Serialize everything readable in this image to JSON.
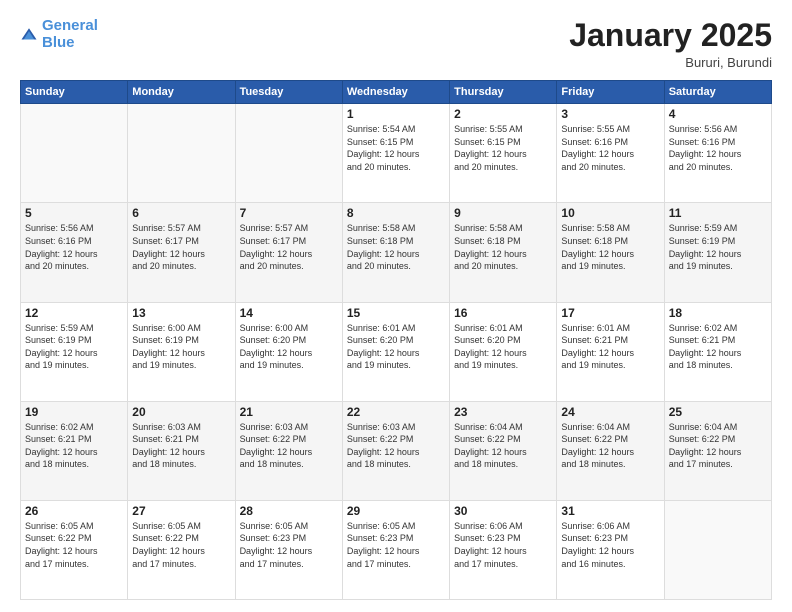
{
  "header": {
    "logo_line1": "General",
    "logo_line2": "Blue",
    "month": "January 2025",
    "location": "Bururi, Burundi"
  },
  "days_of_week": [
    "Sunday",
    "Monday",
    "Tuesday",
    "Wednesday",
    "Thursday",
    "Friday",
    "Saturday"
  ],
  "weeks": [
    [
      {
        "day": "",
        "info": ""
      },
      {
        "day": "",
        "info": ""
      },
      {
        "day": "",
        "info": ""
      },
      {
        "day": "1",
        "info": "Sunrise: 5:54 AM\nSunset: 6:15 PM\nDaylight: 12 hours\nand 20 minutes."
      },
      {
        "day": "2",
        "info": "Sunrise: 5:55 AM\nSunset: 6:15 PM\nDaylight: 12 hours\nand 20 minutes."
      },
      {
        "day": "3",
        "info": "Sunrise: 5:55 AM\nSunset: 6:16 PM\nDaylight: 12 hours\nand 20 minutes."
      },
      {
        "day": "4",
        "info": "Sunrise: 5:56 AM\nSunset: 6:16 PM\nDaylight: 12 hours\nand 20 minutes."
      }
    ],
    [
      {
        "day": "5",
        "info": "Sunrise: 5:56 AM\nSunset: 6:16 PM\nDaylight: 12 hours\nand 20 minutes."
      },
      {
        "day": "6",
        "info": "Sunrise: 5:57 AM\nSunset: 6:17 PM\nDaylight: 12 hours\nand 20 minutes."
      },
      {
        "day": "7",
        "info": "Sunrise: 5:57 AM\nSunset: 6:17 PM\nDaylight: 12 hours\nand 20 minutes."
      },
      {
        "day": "8",
        "info": "Sunrise: 5:58 AM\nSunset: 6:18 PM\nDaylight: 12 hours\nand 20 minutes."
      },
      {
        "day": "9",
        "info": "Sunrise: 5:58 AM\nSunset: 6:18 PM\nDaylight: 12 hours\nand 20 minutes."
      },
      {
        "day": "10",
        "info": "Sunrise: 5:58 AM\nSunset: 6:18 PM\nDaylight: 12 hours\nand 19 minutes."
      },
      {
        "day": "11",
        "info": "Sunrise: 5:59 AM\nSunset: 6:19 PM\nDaylight: 12 hours\nand 19 minutes."
      }
    ],
    [
      {
        "day": "12",
        "info": "Sunrise: 5:59 AM\nSunset: 6:19 PM\nDaylight: 12 hours\nand 19 minutes."
      },
      {
        "day": "13",
        "info": "Sunrise: 6:00 AM\nSunset: 6:19 PM\nDaylight: 12 hours\nand 19 minutes."
      },
      {
        "day": "14",
        "info": "Sunrise: 6:00 AM\nSunset: 6:20 PM\nDaylight: 12 hours\nand 19 minutes."
      },
      {
        "day": "15",
        "info": "Sunrise: 6:01 AM\nSunset: 6:20 PM\nDaylight: 12 hours\nand 19 minutes."
      },
      {
        "day": "16",
        "info": "Sunrise: 6:01 AM\nSunset: 6:20 PM\nDaylight: 12 hours\nand 19 minutes."
      },
      {
        "day": "17",
        "info": "Sunrise: 6:01 AM\nSunset: 6:21 PM\nDaylight: 12 hours\nand 19 minutes."
      },
      {
        "day": "18",
        "info": "Sunrise: 6:02 AM\nSunset: 6:21 PM\nDaylight: 12 hours\nand 18 minutes."
      }
    ],
    [
      {
        "day": "19",
        "info": "Sunrise: 6:02 AM\nSunset: 6:21 PM\nDaylight: 12 hours\nand 18 minutes."
      },
      {
        "day": "20",
        "info": "Sunrise: 6:03 AM\nSunset: 6:21 PM\nDaylight: 12 hours\nand 18 minutes."
      },
      {
        "day": "21",
        "info": "Sunrise: 6:03 AM\nSunset: 6:22 PM\nDaylight: 12 hours\nand 18 minutes."
      },
      {
        "day": "22",
        "info": "Sunrise: 6:03 AM\nSunset: 6:22 PM\nDaylight: 12 hours\nand 18 minutes."
      },
      {
        "day": "23",
        "info": "Sunrise: 6:04 AM\nSunset: 6:22 PM\nDaylight: 12 hours\nand 18 minutes."
      },
      {
        "day": "24",
        "info": "Sunrise: 6:04 AM\nSunset: 6:22 PM\nDaylight: 12 hours\nand 18 minutes."
      },
      {
        "day": "25",
        "info": "Sunrise: 6:04 AM\nSunset: 6:22 PM\nDaylight: 12 hours\nand 17 minutes."
      }
    ],
    [
      {
        "day": "26",
        "info": "Sunrise: 6:05 AM\nSunset: 6:22 PM\nDaylight: 12 hours\nand 17 minutes."
      },
      {
        "day": "27",
        "info": "Sunrise: 6:05 AM\nSunset: 6:22 PM\nDaylight: 12 hours\nand 17 minutes."
      },
      {
        "day": "28",
        "info": "Sunrise: 6:05 AM\nSunset: 6:23 PM\nDaylight: 12 hours\nand 17 minutes."
      },
      {
        "day": "29",
        "info": "Sunrise: 6:05 AM\nSunset: 6:23 PM\nDaylight: 12 hours\nand 17 minutes."
      },
      {
        "day": "30",
        "info": "Sunrise: 6:06 AM\nSunset: 6:23 PM\nDaylight: 12 hours\nand 17 minutes."
      },
      {
        "day": "31",
        "info": "Sunrise: 6:06 AM\nSunset: 6:23 PM\nDaylight: 12 hours\nand 16 minutes."
      },
      {
        "day": "",
        "info": ""
      }
    ]
  ]
}
